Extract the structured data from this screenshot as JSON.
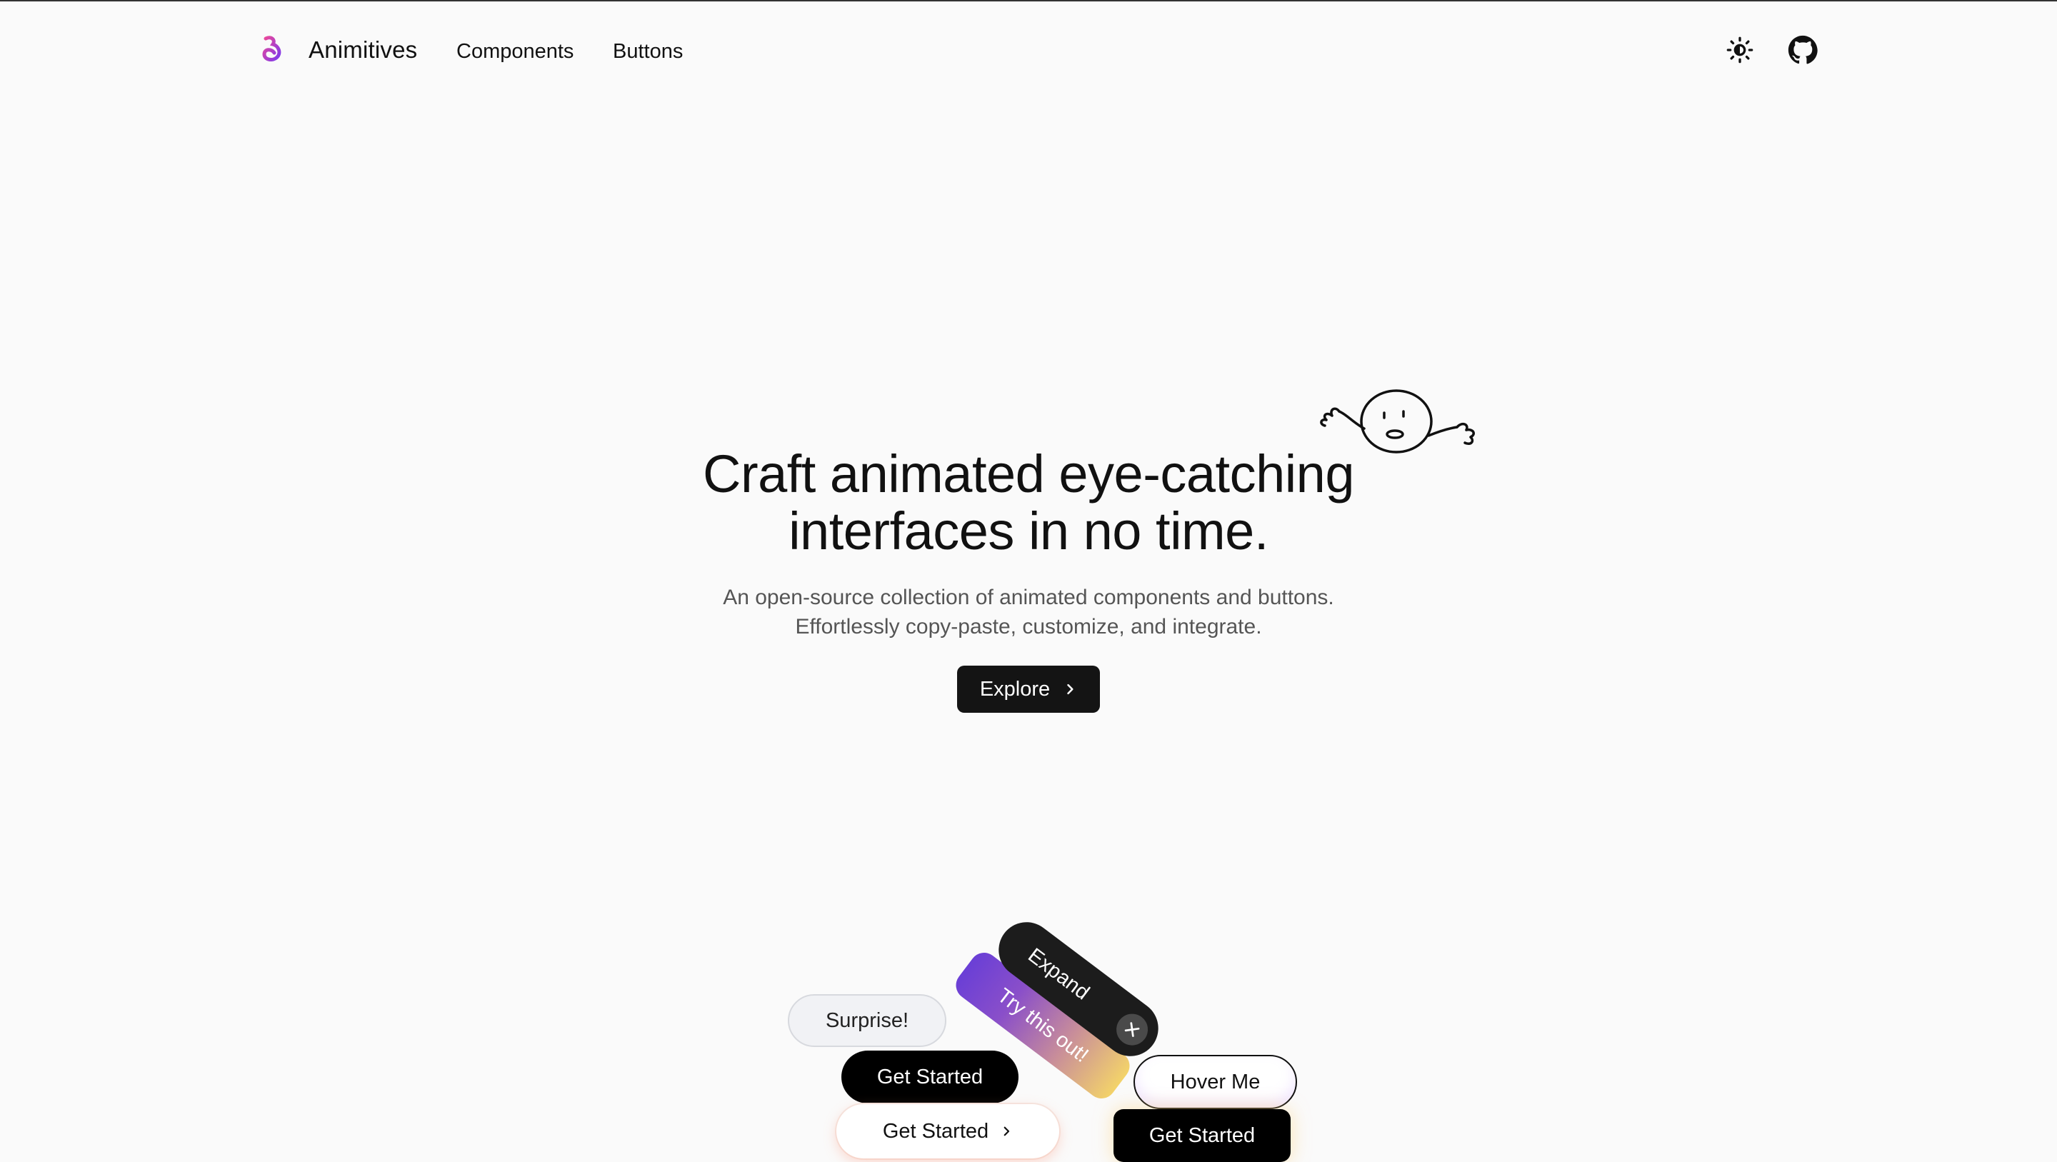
{
  "nav": {
    "brand": "Animitives",
    "links": [
      "Components",
      "Buttons"
    ],
    "theme_toggle_icon": "sun-moon-icon",
    "github_icon": "github-icon",
    "logo_colors": [
      "#ec4899",
      "#7c3aed"
    ]
  },
  "hero": {
    "title_lines": [
      "Craft animated eye-catching",
      "interfaces in no time."
    ],
    "subtitle_lines": [
      "An open-source collection of animated components and buttons.",
      "Effortlessly copy-paste, customize, and integrate."
    ],
    "cta_label": "Explore",
    "cta_icon": "chevron-right-icon"
  },
  "showcase": {
    "surprise": "Surprise!",
    "get_started_1": "Get Started",
    "get_started_2": "Get Started",
    "get_started_3": "Get Started",
    "hover_me": "Hover Me",
    "expand": "Expand",
    "try_this": "Try this out!"
  }
}
